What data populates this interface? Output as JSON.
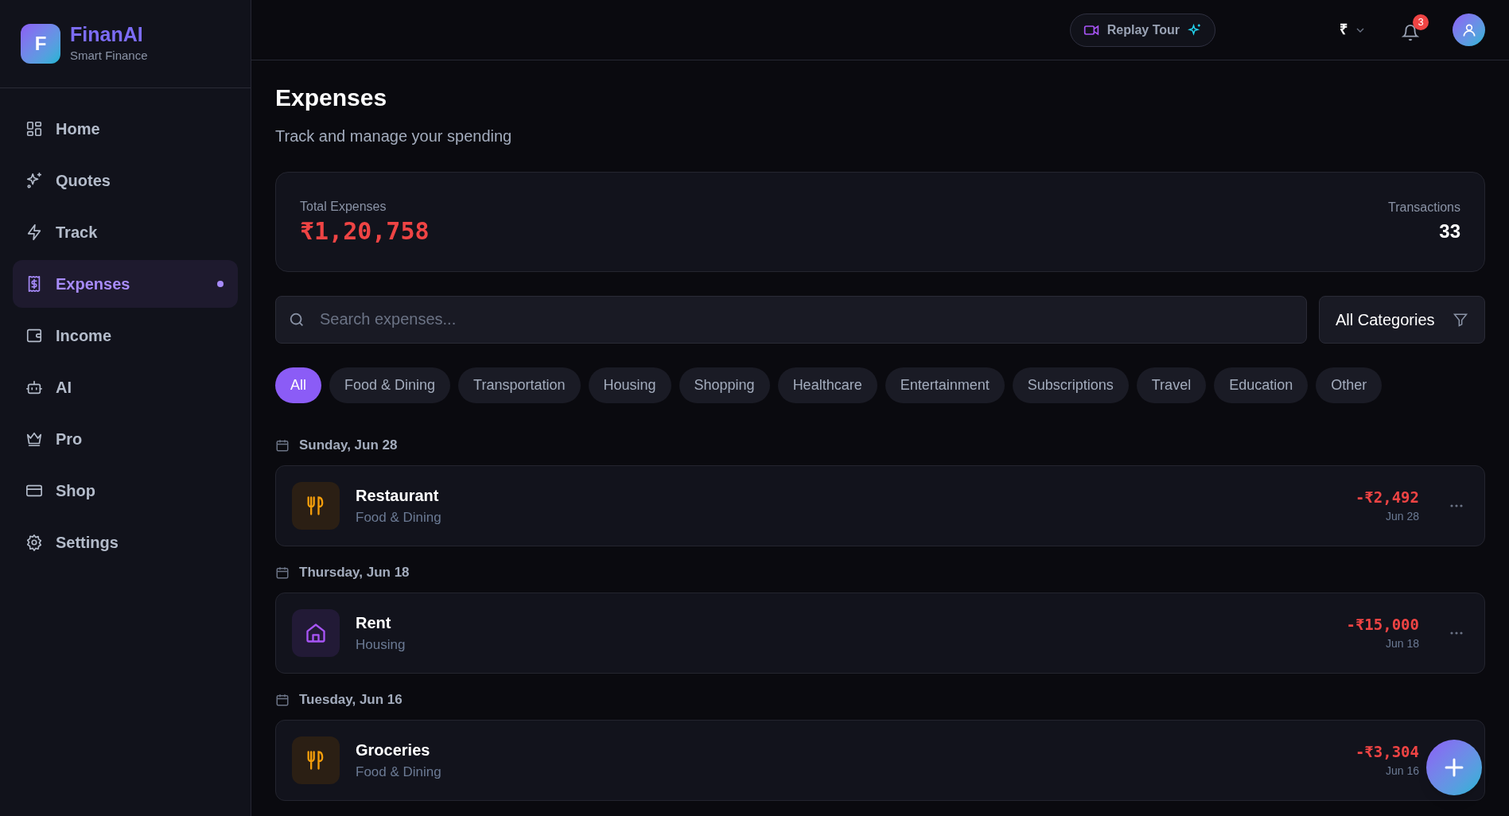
{
  "brand": {
    "logo_letter": "F",
    "name": "FinanAI",
    "tagline": "Smart Finance"
  },
  "sidebar": {
    "items": [
      {
        "label": "Home",
        "selected": false
      },
      {
        "label": "Quotes",
        "selected": false
      },
      {
        "label": "Track",
        "selected": false
      },
      {
        "label": "Expenses",
        "selected": true
      },
      {
        "label": "Income",
        "selected": false
      },
      {
        "label": "AI",
        "selected": false
      },
      {
        "label": "Pro",
        "selected": false
      },
      {
        "label": "Shop",
        "selected": false
      },
      {
        "label": "Settings",
        "selected": false
      }
    ]
  },
  "topbar": {
    "tour_button": "Replay Tour",
    "currency": "₹",
    "notification_count": "3"
  },
  "page": {
    "title": "Expenses",
    "subtitle": "Track and manage your spending"
  },
  "summary": {
    "total_label": "Total Expenses",
    "total": "₹1,20,758",
    "count_label": "Transactions",
    "count": "33"
  },
  "search": {
    "placeholder": "Search expenses..."
  },
  "category_filter": "All Categories",
  "chips": [
    {
      "label": "All",
      "selected": true
    },
    {
      "label": "Food & Dining",
      "selected": false
    },
    {
      "label": "Transportation",
      "selected": false
    },
    {
      "label": "Housing",
      "selected": false
    },
    {
      "label": "Shopping",
      "selected": false
    },
    {
      "label": "Healthcare",
      "selected": false
    },
    {
      "label": "Entertainment",
      "selected": false
    },
    {
      "label": "Subscriptions",
      "selected": false
    },
    {
      "label": "Travel",
      "selected": false
    },
    {
      "label": "Education",
      "selected": false
    },
    {
      "label": "Other",
      "selected": false
    }
  ],
  "groups": [
    {
      "date": "Sunday, Jun 28",
      "items": [
        {
          "kind": "food",
          "name": "Restaurant",
          "category": "Food & Dining",
          "amount": "-₹2,492",
          "date": "Jun 28",
          "menu_button": true
        }
      ]
    },
    {
      "date": "Thursday, Jun 18",
      "items": [
        {
          "kind": "housing",
          "name": "Rent",
          "category": "Housing",
          "amount": "-₹15,000",
          "date": "Jun 18",
          "menu_button": true
        }
      ]
    },
    {
      "date": "Tuesday, Jun 16",
      "items": [
        {
          "kind": "food",
          "name": "Groceries",
          "category": "Food & Dining",
          "amount": "-₹3,304",
          "date": "Jun 16",
          "menu_button": false
        }
      ]
    }
  ]
}
